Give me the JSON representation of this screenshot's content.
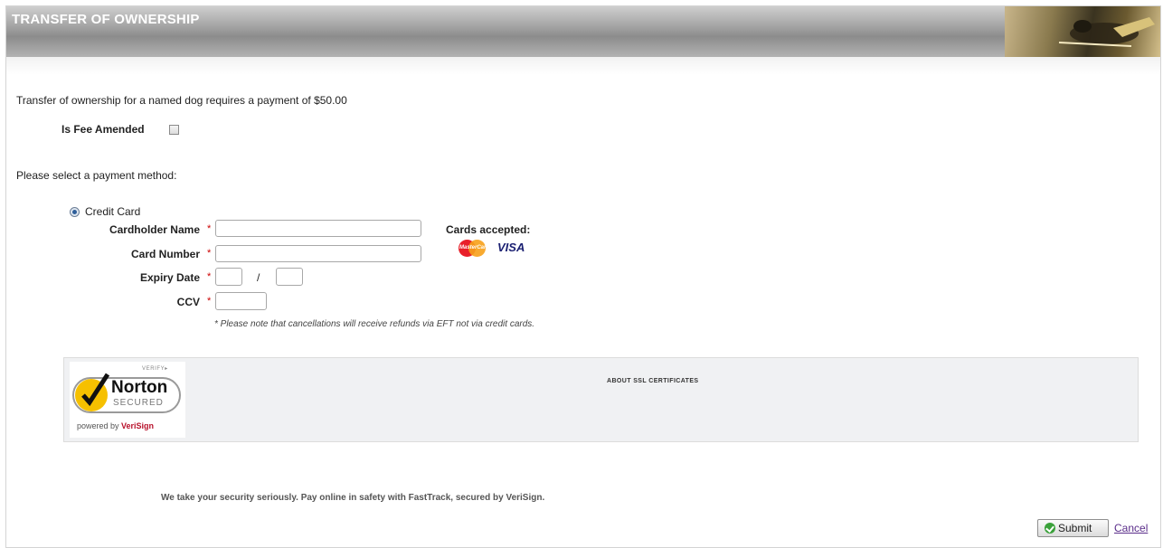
{
  "header": {
    "title": "TRANSFER OF OWNERSHIP"
  },
  "intro": {
    "text": "Transfer of ownership for a named dog requires a payment of $50.00"
  },
  "fee": {
    "label": "Is Fee Amended"
  },
  "payment": {
    "prompt": "Please select a payment method:",
    "method_label": "Credit Card",
    "required_mark": "*",
    "fields": {
      "cardholder_name": "Cardholder Name",
      "card_number": "Card Number",
      "expiry_date": "Expiry Date",
      "expiry_sep": "/",
      "ccv": "CCV"
    },
    "cards_accepted": "Cards accepted:",
    "mastercard_text": "MasterCard",
    "visa_text": "VISA",
    "note": "* Please note that cancellations will receive refunds via EFT not via credit cards."
  },
  "ssl": {
    "title": "ABOUT SSL CERTIFICATES",
    "verify": "VERIFY▸",
    "norton": "Norton",
    "secured": "SECURED",
    "powered_by": "powered by ",
    "verisign": "VeriSign"
  },
  "security_message": "We take your security seriously. Pay online in safety with FastTrack, secured by VeriSign.",
  "actions": {
    "submit": "Submit",
    "cancel": "Cancel"
  }
}
